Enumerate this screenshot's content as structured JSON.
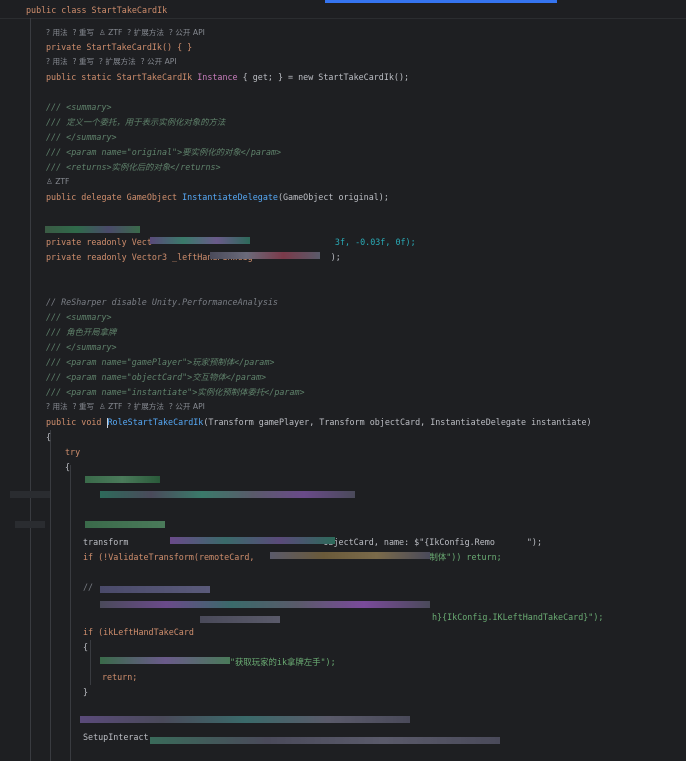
{
  "sticky_header": "public class StartTakeCardIk",
  "accent_color": "#3574f0",
  "hints": {
    "h1": "? 用法  ? 重写  ♙ ZTF  ? 扩展方法  ? 公开 API",
    "h2": "? 用法  ? 重写  ? 扩展方法  ? 公开 API",
    "h3": "♙ ZTF",
    "h4": "? 用法  ? 重写  ♙ ZTF  ? 扩展方法  ? 公开 API"
  },
  "code": {
    "ctor": "private StartTakeCardIk() { }",
    "inst_1": "public static StartTakeCardIk ",
    "inst_2": "Instance",
    "inst_3": " { get; } = new StartTakeCardIk();",
    "d1": "/// <summary>",
    "d2": "/// 定义一个委托，用于表示实例化对象的方法",
    "d3": "/// </summary>",
    "d4": "/// <param name=\"original\">要实例化的对象</param>",
    "d5": "/// <returns>实例化后的对象</returns>",
    "deleg_1": "public delegate GameObject ",
    "deleg_2": "InstantiateDelegate",
    "deleg_3": "(GameObject original);",
    "ro1": "private readonly Vect",
    "ro1_b": " 3f, -0.03f, 0f);",
    "ro2": "private readonly Vector3 _leftHandPinWeig",
    "ro2_b": ");",
    "perf": "// ReSharper disable Unity.PerformanceAnalysis",
    "e1": "/// <summary>",
    "e2": "/// 角色开局拿牌",
    "e3": "/// </summary>",
    "e4": "/// <param name=\"gamePlayer\">玩家预制体</param>",
    "e5": "/// <param name=\"objectCard\">交互物体</param>",
    "e6": "/// <param name=\"instantiate\">实例化预制体委托</param>",
    "role_1": "public void ",
    "role_2": "RoleStartTakeCardIk",
    "role_3": "(Transform gamePlayer, Transform objectCard, InstantiateDelegate instantiate)",
    "brace_open": "{",
    "try": "try",
    "l_remote_a": "transform ",
    "l_remote_b": "ObjectCard, name: $\"{IkConfig.Remo",
    "l_remote_c": "\");",
    "l_validate_a": "if (!ValidateTransform(remoteCard, ",
    "l_validate_b": "制体\")) return;",
    "l_comment": "// ",
    "l_find_a": "h}{IkConfig.IKLeftHandTakeCard}\");",
    "l_if": "if (ikLeftHandTakeCard",
    "l_warn": "\"获取玩家的ik拿牌左手\");",
    "l_return": "return;",
    "brace_close": "}",
    "l_setup": "SetupInteract"
  }
}
